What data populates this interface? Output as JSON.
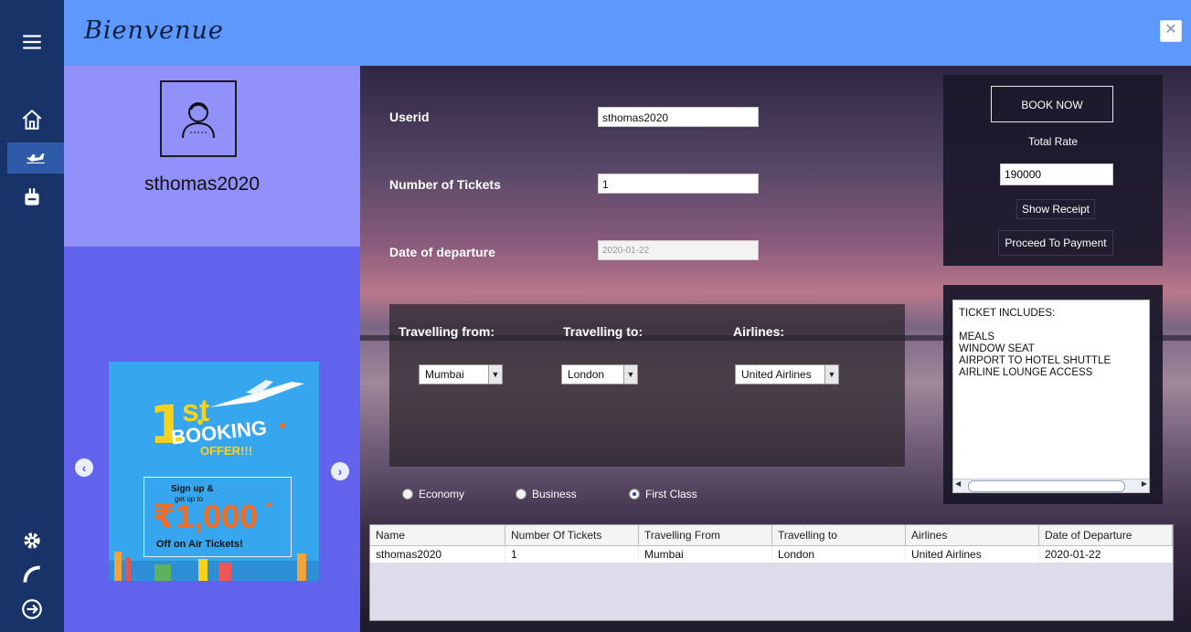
{
  "header": {
    "brand": "Bienvenue",
    "close_label": "✕"
  },
  "nav": {
    "items": [
      {
        "name": "menu-icon"
      },
      {
        "name": "home-icon"
      },
      {
        "name": "airplane-icon",
        "active": true
      },
      {
        "name": "luggage-icon"
      },
      {
        "name": "settings-icon"
      },
      {
        "name": "phone-icon"
      },
      {
        "name": "logout-icon"
      }
    ]
  },
  "profile": {
    "username": "sthomas2020",
    "avatar_icon": "user-icon"
  },
  "ad": {
    "line1": "1",
    "line1_suffix": "st",
    "line2": "BOOKING",
    "line3": "OFFER!!!",
    "line4": "Sign up &",
    "line5": "get up to",
    "amount": "₹1,000",
    "amount_suffix": "*",
    "line6": "Off on Air Tickets!",
    "prev_label": "‹",
    "next_label": "›"
  },
  "form": {
    "userid_label": "Userid",
    "userid_value": "sthomas2020",
    "tickets_label": "Number of Tickets",
    "tickets_value": "1",
    "date_label": "Date of departure",
    "date_value": "2020-01-22"
  },
  "route": {
    "from_label": "Travelling from:",
    "to_label": "Travelling to:",
    "airline_label": "Airlines:",
    "from_value": "Mumbai",
    "to_value": "London",
    "airline_value": "United Airlines",
    "dropdown_arrow": "▼"
  },
  "classes": {
    "options": [
      {
        "label": "Economy",
        "checked": false
      },
      {
        "label": "Business",
        "checked": false
      },
      {
        "label": "First Class",
        "checked": true
      }
    ]
  },
  "booking": {
    "book_now": "BOOK NOW",
    "total_label": "Total Rate",
    "total_value": "190000",
    "show_receipt": "Show Receipt",
    "proceed": "Proceed To Payment"
  },
  "includes": {
    "heading": "TICKET INCLUDES:",
    "items": [
      "MEALS",
      "WINDOW SEAT",
      "AIRPORT TO HOTEL SHUTTLE",
      "AIRLINE LOUNGE ACCESS"
    ]
  },
  "table": {
    "columns": [
      "Name",
      "Number Of Tickets",
      "Travelling From",
      "Travelling to",
      "Airlines",
      "Date of Departure"
    ],
    "rows": [
      [
        "sthomas2020",
        "1",
        "Mumbai",
        "London",
        "United Airlines",
        "2020-01-22"
      ]
    ]
  },
  "colors": {
    "nav": "#173367",
    "header": "#5d99fd",
    "profile": "#9290f9",
    "ad_panel": "#6263ec",
    "accent_yellow": "#f7d21c",
    "accent_orange": "#f26c22"
  }
}
